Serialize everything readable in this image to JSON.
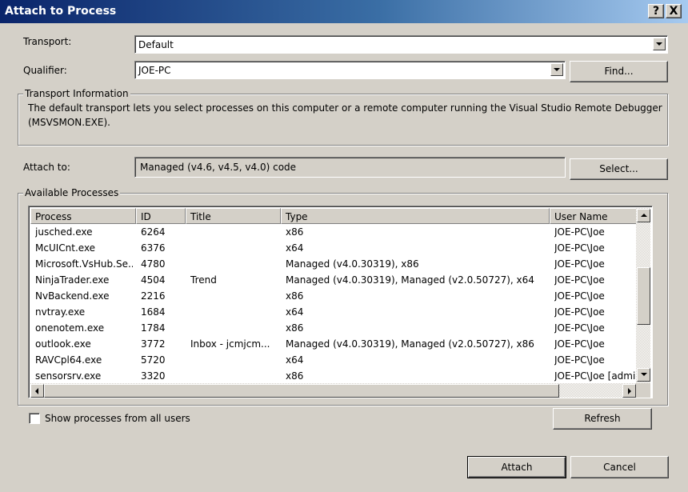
{
  "window": {
    "title": "Attach to Process",
    "help_label": "?",
    "close_label": "X"
  },
  "transport": {
    "label": "Transport:",
    "value": "Default"
  },
  "qualifier": {
    "label": "Qualifier:",
    "value": "JOE-PC",
    "find_label": "Find..."
  },
  "transport_info": {
    "legend": "Transport Information",
    "line1": "The default transport lets you select processes on this computer or a remote computer running the Visual Studio Remote Debugger",
    "line2": "(MSVSMON.EXE)."
  },
  "attach_to": {
    "label": "Attach to:",
    "value": "Managed (v4.6, v4.5, v4.0) code",
    "select_label": "Select..."
  },
  "processes": {
    "legend": "Available Processes",
    "columns": [
      "Process",
      "ID",
      "Title",
      "Type",
      "User Name"
    ],
    "rows": [
      {
        "process": "jusched.exe",
        "id": "6264",
        "title": "",
        "type": "x86",
        "user": "JOE-PC\\Joe"
      },
      {
        "process": "McUICnt.exe",
        "id": "6376",
        "title": "",
        "type": "x64",
        "user": "JOE-PC\\Joe"
      },
      {
        "process": "Microsoft.VsHub.Se...",
        "id": "4780",
        "title": "",
        "type": "Managed (v4.0.30319), x86",
        "user": "JOE-PC\\Joe"
      },
      {
        "process": "NinjaTrader.exe",
        "id": "4504",
        "title": "Trend",
        "type": "Managed (v4.0.30319), Managed (v2.0.50727), x64",
        "user": "JOE-PC\\Joe"
      },
      {
        "process": "NvBackend.exe",
        "id": "2216",
        "title": "",
        "type": "x86",
        "user": "JOE-PC\\Joe"
      },
      {
        "process": "nvtray.exe",
        "id": "1684",
        "title": "",
        "type": "x64",
        "user": "JOE-PC\\Joe"
      },
      {
        "process": "onenotem.exe",
        "id": "1784",
        "title": "",
        "type": "x86",
        "user": "JOE-PC\\Joe"
      },
      {
        "process": "outlook.exe",
        "id": "3772",
        "title": "Inbox - jcmjcm...",
        "type": "Managed (v4.0.30319), Managed (v2.0.50727), x86",
        "user": "JOE-PC\\Joe"
      },
      {
        "process": "RAVCpl64.exe",
        "id": "5720",
        "title": "",
        "type": "x64",
        "user": "JOE-PC\\Joe"
      },
      {
        "process": "sensorsrv.exe",
        "id": "3320",
        "title": "",
        "type": "x86",
        "user": "JOE-PC\\Joe [admi"
      }
    ]
  },
  "show_all_users": {
    "label": "Show processes from all users",
    "checked": false
  },
  "buttons": {
    "refresh": "Refresh",
    "attach": "Attach",
    "cancel": "Cancel"
  },
  "colors": {
    "title_start": "#0a246a",
    "title_end": "#a6caf0",
    "face": "#d4d0c8"
  }
}
